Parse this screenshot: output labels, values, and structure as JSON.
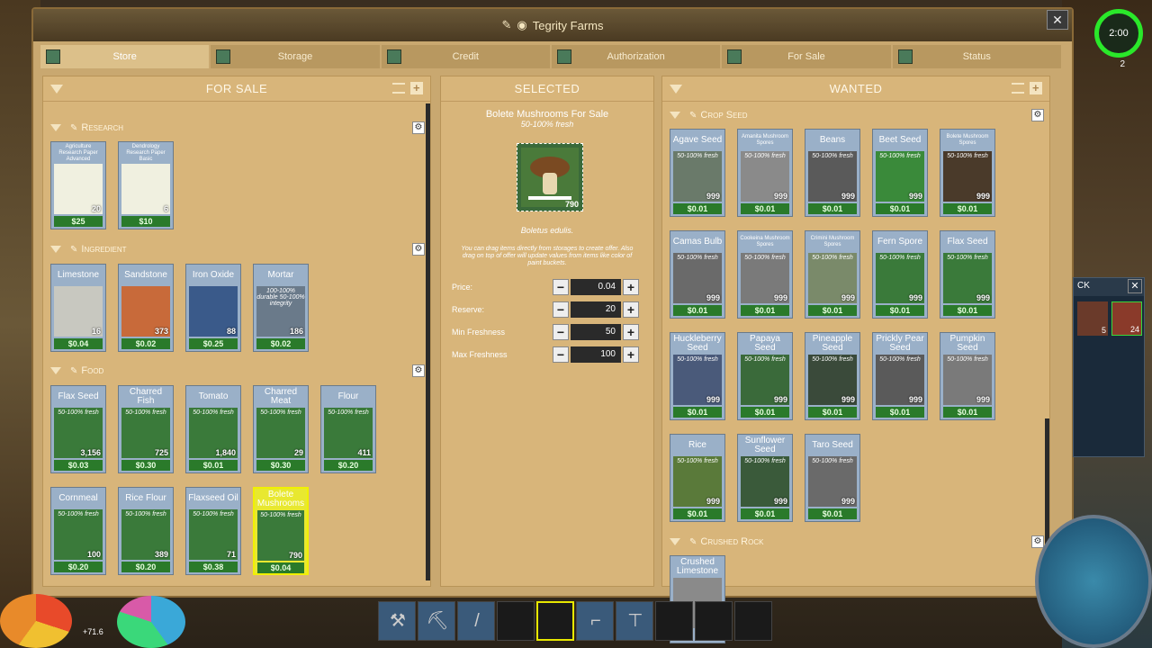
{
  "window": {
    "title": "Tegrity Farms",
    "close": "✕"
  },
  "tabs": [
    {
      "label": "Store",
      "active": true
    },
    {
      "label": "Storage",
      "active": false
    },
    {
      "label": "Credit",
      "active": false
    },
    {
      "label": "Authorization",
      "active": false
    },
    {
      "label": "For Sale",
      "active": false
    },
    {
      "label": "Status",
      "active": false
    }
  ],
  "for_sale": {
    "title": "FOR SALE",
    "categories": [
      {
        "name": "Research",
        "items": [
          {
            "name": "Agriculture Research Paper Advanced",
            "qty": "20",
            "price": "$25",
            "fresh": "",
            "color": "#f0f0e0"
          },
          {
            "name": "Dendrology Research Paper Basic",
            "qty": "6",
            "price": "$10",
            "fresh": "",
            "color": "#f0f0e0"
          }
        ]
      },
      {
        "name": "Ingredient",
        "items": [
          {
            "name": "Limestone",
            "qty": "16",
            "price": "$0.04",
            "fresh": "",
            "color": "#c8c8c0"
          },
          {
            "name": "Sandstone",
            "qty": "373",
            "price": "$0.02",
            "fresh": "",
            "color": "#c86a3a"
          },
          {
            "name": "Iron Oxide",
            "qty": "88",
            "price": "$0.25",
            "fresh": "",
            "color": "#3a5a8a"
          },
          {
            "name": "Mortar",
            "qty": "186",
            "price": "$0.02",
            "fresh": "100-100% durable 50-100% integrity",
            "color": "#6a7a8a"
          }
        ]
      },
      {
        "name": "Food",
        "items": [
          {
            "name": "Flax Seed",
            "qty": "3,156",
            "price": "$0.03",
            "fresh": "50-100% fresh",
            "color": "#3a7a3a"
          },
          {
            "name": "Charred Fish",
            "qty": "725",
            "price": "$0.30",
            "fresh": "50-100% fresh",
            "color": "#3a7a3a"
          },
          {
            "name": "Tomato",
            "qty": "1,840",
            "price": "$0.01",
            "fresh": "50-100% fresh",
            "color": "#3a7a3a"
          },
          {
            "name": "Charred Meat",
            "qty": "29",
            "price": "$0.30",
            "fresh": "50-100% fresh",
            "color": "#3a7a3a"
          },
          {
            "name": "Flour",
            "qty": "411",
            "price": "$0.20",
            "fresh": "50-100% fresh",
            "color": "#3a7a3a"
          },
          {
            "name": "Cornmeal",
            "qty": "100",
            "price": "$0.20",
            "fresh": "50-100% fresh",
            "color": "#3a7a3a"
          },
          {
            "name": "Rice Flour",
            "qty": "389",
            "price": "$0.20",
            "fresh": "50-100% fresh",
            "color": "#3a7a3a"
          },
          {
            "name": "Flaxseed Oil",
            "qty": "71",
            "price": "$0.38",
            "fresh": "50-100% fresh",
            "color": "#3a7a3a"
          },
          {
            "name": "Bolete Mushrooms",
            "qty": "790",
            "price": "$0.04",
            "fresh": "50-100% fresh",
            "color": "#3a7a3a"
          }
        ]
      }
    ]
  },
  "selected": {
    "title": "SELECTED",
    "item_title": "Bolete Mushrooms For Sale",
    "item_sub": "50-100% fresh",
    "qty": "790",
    "latin": "Boletus edulis.",
    "hint": "You can drag items directly from storages to create offer. Also drag on top of offer will update values from items like color of paint buckets.",
    "fields": [
      {
        "label": "Price:",
        "value": "0.04"
      },
      {
        "label": "Reserve:",
        "value": "20"
      },
      {
        "label": "Min Freshness",
        "value": "50"
      },
      {
        "label": "Max Freshness",
        "value": "100"
      }
    ]
  },
  "wanted": {
    "title": "WANTED",
    "categories": [
      {
        "name": "Crop Seed",
        "items": [
          {
            "name": "Agave Seed",
            "qty": "999",
            "price": "$0.01"
          },
          {
            "name": "Amanita Mushroom Spores",
            "qty": "999",
            "price": "$0.01"
          },
          {
            "name": "Beans",
            "qty": "999",
            "price": "$0.01"
          },
          {
            "name": "Beet Seed",
            "qty": "999",
            "price": "$0.01"
          },
          {
            "name": "Bolete Mushroom Spores",
            "qty": "999",
            "price": "$0.01"
          },
          {
            "name": "Camas Bulb",
            "qty": "999",
            "price": "$0.01"
          },
          {
            "name": "Cookeina Mushroom Spores",
            "qty": "999",
            "price": "$0.01"
          },
          {
            "name": "Crimini Mushroom Spores",
            "qty": "999",
            "price": "$0.01"
          },
          {
            "name": "Fern Spore",
            "qty": "999",
            "price": "$0.01"
          },
          {
            "name": "Flax Seed",
            "qty": "999",
            "price": "$0.01"
          },
          {
            "name": "Huckleberry Seed",
            "qty": "999",
            "price": "$0.01"
          },
          {
            "name": "Papaya Seed",
            "qty": "999",
            "price": "$0.01"
          },
          {
            "name": "Pineapple Seed",
            "qty": "999",
            "price": "$0.01"
          },
          {
            "name": "Prickly Pear Seed",
            "qty": "999",
            "price": "$0.01"
          },
          {
            "name": "Pumpkin Seed",
            "qty": "999",
            "price": "$0.01"
          },
          {
            "name": "Rice",
            "qty": "999",
            "price": "$0.01"
          },
          {
            "name": "Sunflower Seed",
            "qty": "999",
            "price": "$0.01"
          },
          {
            "name": "Taro Seed",
            "qty": "999",
            "price": "$0.01"
          }
        ]
      },
      {
        "name": "Crushed Rock",
        "items": [
          {
            "name": "Crushed Limestone",
            "qty": "",
            "price": ""
          }
        ]
      }
    ],
    "fresh": "50-100% fresh"
  },
  "hud": {
    "clock": "2:00",
    "level": "2",
    "stat": "+71.6",
    "side_panel_label": "CK",
    "side_panel_qty1": "5",
    "side_panel_qty2": "24"
  }
}
